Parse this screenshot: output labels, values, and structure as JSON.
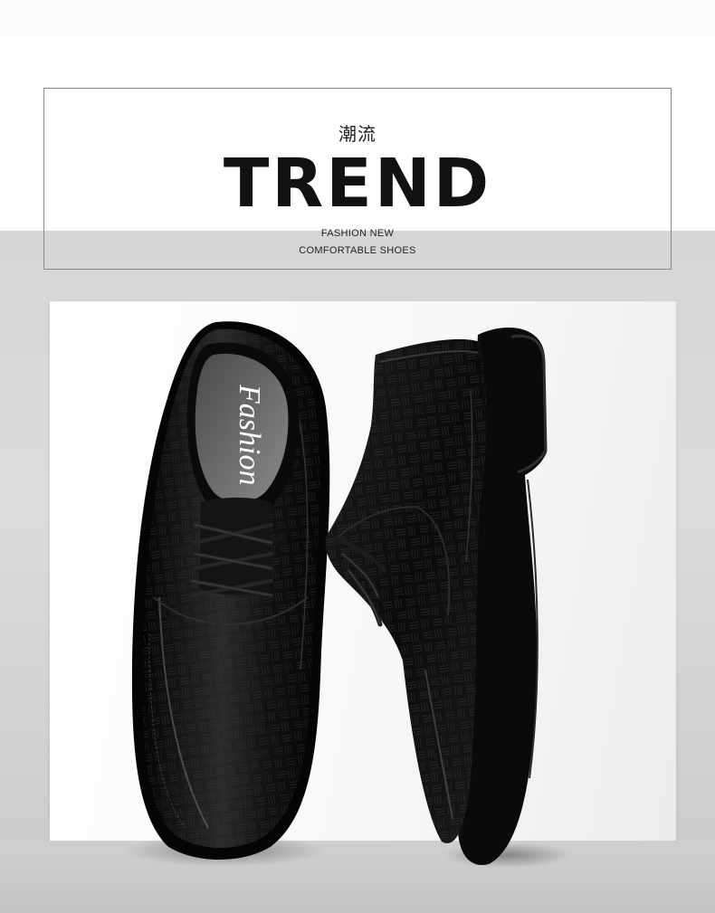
{
  "header": {
    "title_cn": "潮流",
    "title_en": "TREND",
    "subtitle_line1": "FASHION NEW",
    "subtitle_line2": "COMFORTABLE SHOES"
  },
  "product": {
    "insole_text": "Fashion"
  },
  "colors": {
    "leather": "#111111",
    "background_light": "#ffffff",
    "background_gray": "#d8d8d8",
    "border": "#8a8a8a"
  }
}
